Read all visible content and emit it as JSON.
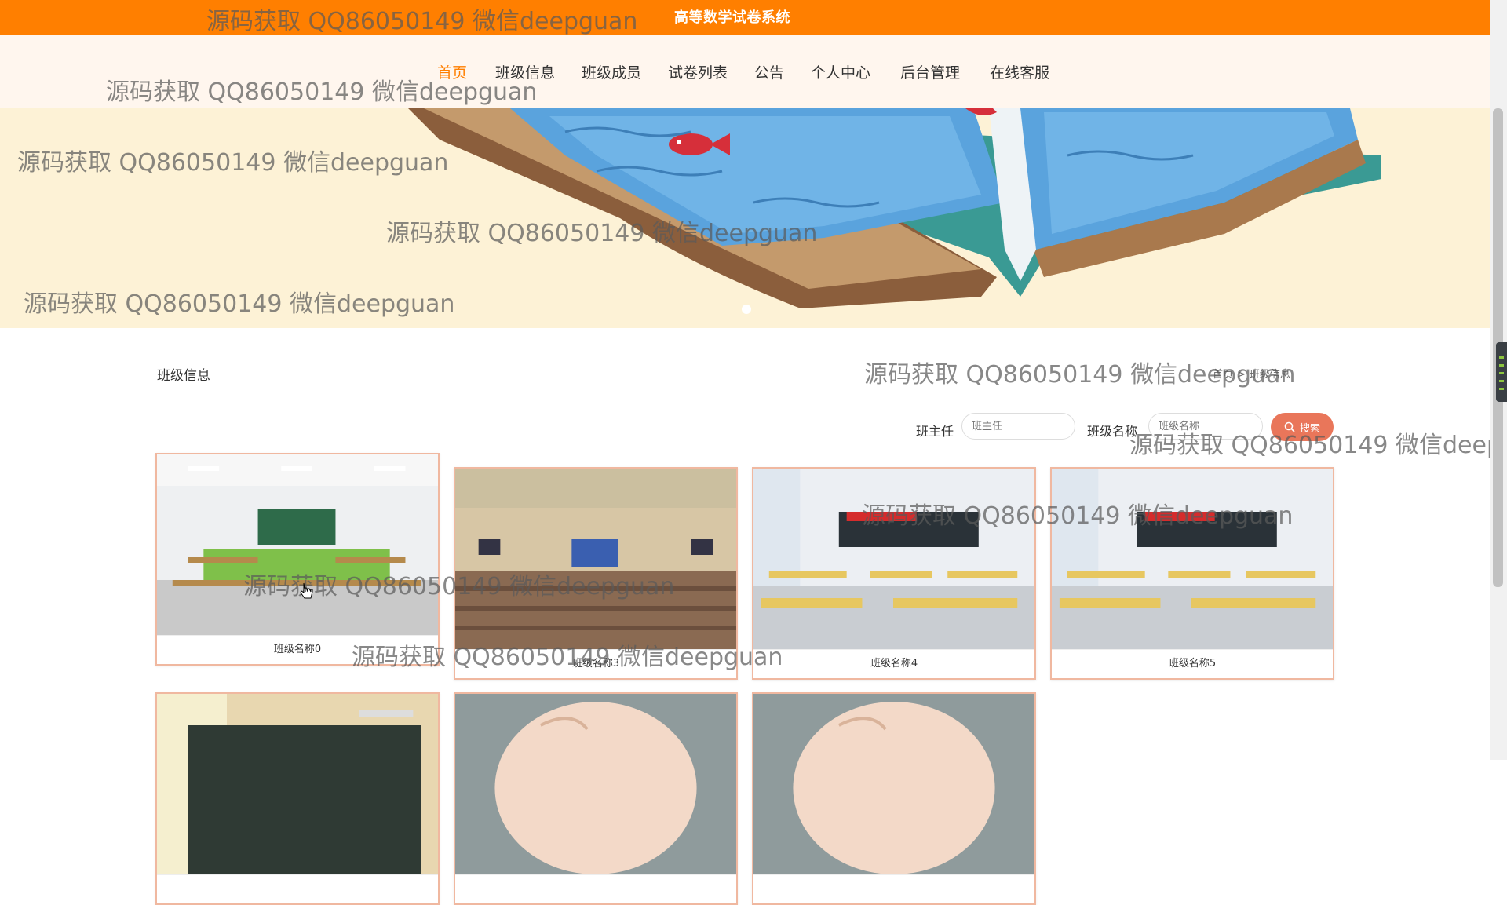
{
  "header": {
    "site_title": "高等数学试卷系统"
  },
  "nav": {
    "items": [
      {
        "label": "首页",
        "active": true
      },
      {
        "label": "班级信息"
      },
      {
        "label": "班级成员"
      },
      {
        "label": "试卷列表"
      },
      {
        "label": "公告"
      },
      {
        "label": "个人中心"
      },
      {
        "label": "后台管理"
      },
      {
        "label": "在线客服"
      }
    ]
  },
  "page": {
    "section_title": "班级信息",
    "breadcrumb": {
      "home": "首页",
      "current": "班级信息"
    }
  },
  "search": {
    "teacher_label": "班主任",
    "teacher_placeholder": "班主任",
    "class_label": "班级名称",
    "class_placeholder": "班级名称",
    "button_label": "搜索"
  },
  "classes": [
    {
      "name": "班级名称0"
    },
    {
      "name": "班级名称3"
    },
    {
      "name": "班级名称4"
    },
    {
      "name": "班级名称5"
    },
    {
      "name": ""
    },
    {
      "name": ""
    },
    {
      "name": ""
    }
  ],
  "watermark_text": "源码获取 QQ86050149 微信deepguan",
  "colors": {
    "brand_orange": "#ff7f00",
    "nav_background": "#fff6ee",
    "banner_background": "#fdf2d6",
    "search_button": "#e9765a",
    "card_border": "#f0b8a0"
  }
}
